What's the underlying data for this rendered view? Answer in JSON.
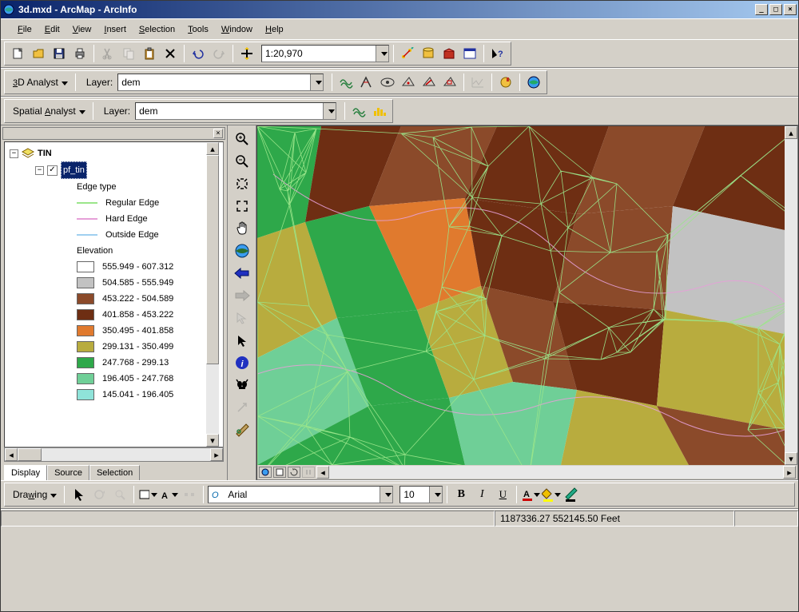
{
  "window": {
    "title": "3d.mxd - ArcMap - ArcInfo"
  },
  "menu": {
    "file": "File",
    "edit": "Edit",
    "view": "View",
    "insert": "Insert",
    "selection": "Selection",
    "tools": "Tools",
    "window": "Window",
    "help": "Help"
  },
  "standard_toolbar": {
    "scale_value": "1:20,970"
  },
  "analyst_3d": {
    "label": "3D Analyst",
    "layer_label": "Layer:",
    "layer_value": "dem"
  },
  "spatial_analyst": {
    "label": "Spatial Analyst",
    "layer_label": "Layer:",
    "layer_value": "dem"
  },
  "toc": {
    "root": "TIN",
    "layer_name": "pf_tin",
    "edge_type_heading": "Edge type",
    "edges": {
      "regular": "Regular Edge",
      "hard": "Hard Edge",
      "outside": "Outside Edge"
    },
    "elevation_heading": "Elevation",
    "elevation_classes": [
      {
        "label": "555.949 - 607.312",
        "color": "#ffffff"
      },
      {
        "label": "504.585 - 555.949",
        "color": "#c2c2c2"
      },
      {
        "label": "453.222 - 504.589",
        "color": "#8b4a2a"
      },
      {
        "label": "401.858 - 453.222",
        "color": "#6e2e13"
      },
      {
        "label": "350.495 - 401.858",
        "color": "#e07a2e"
      },
      {
        "label": "299.131 - 350.499",
        "color": "#b8ac3e"
      },
      {
        "label": "247.768 - 299.13",
        "color": "#2ea84a"
      },
      {
        "label": "196.405 - 247.768",
        "color": "#6fcf97"
      },
      {
        "label": "145.041 - 196.405",
        "color": "#8fe3d9"
      }
    ],
    "tabs": {
      "display": "Display",
      "source": "Source",
      "selection": "Selection"
    }
  },
  "drawing_toolbar": {
    "label": "Drawing",
    "font": "Arial",
    "size": "10"
  },
  "status": {
    "coords": "1187336.27 552145.50 Feet"
  },
  "colors": {
    "regular_edge": "#9be68a",
    "hard_edge": "#e6a0d8",
    "outside_edge": "#a0d0f0"
  }
}
